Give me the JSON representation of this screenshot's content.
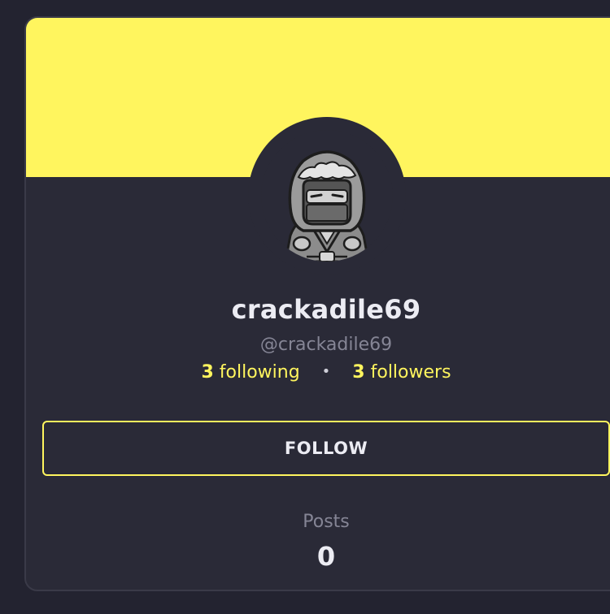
{
  "profile": {
    "display_name": "crackadile69",
    "handle": "@crackadile69",
    "avatar_icon": "hooded-ninja-avatar",
    "banner_color": "#fff55e",
    "accent_color": "#fff55e",
    "stats": {
      "following_count": "3",
      "following_label": "following",
      "separator": "•",
      "followers_count": "3",
      "followers_label": "followers"
    },
    "follow_button_label": "FOLLOW",
    "posts": {
      "label": "Posts",
      "count": "0"
    }
  }
}
